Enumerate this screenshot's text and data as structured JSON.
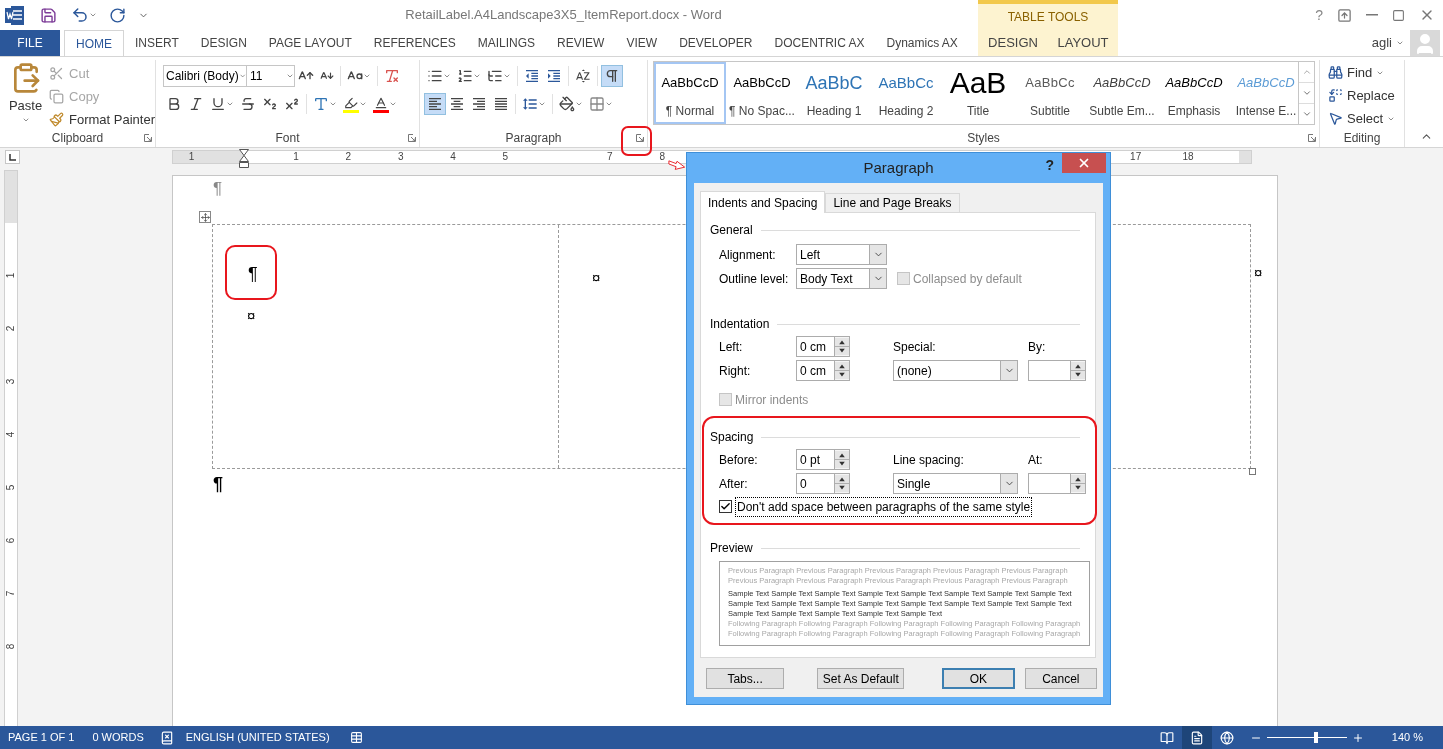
{
  "title_bar": {
    "title": "RetailLabel.A4Landscape3X5_ItemReport.docx - Word",
    "help": "?"
  },
  "tabs": [
    {
      "label": "FILE",
      "kind": "file",
      "selected": false
    },
    {
      "label": "HOME",
      "kind": "normal",
      "selected": true
    },
    {
      "label": "INSERT",
      "kind": "normal",
      "selected": false
    },
    {
      "label": "DESIGN",
      "kind": "normal",
      "selected": false
    },
    {
      "label": "PAGE LAYOUT",
      "kind": "normal",
      "selected": false
    },
    {
      "label": "REFERENCES",
      "kind": "normal",
      "selected": false
    },
    {
      "label": "MAILINGS",
      "kind": "normal",
      "selected": false
    },
    {
      "label": "REVIEW",
      "kind": "normal",
      "selected": false
    },
    {
      "label": "VIEW",
      "kind": "normal",
      "selected": false
    },
    {
      "label": "DEVELOPER",
      "kind": "normal",
      "selected": false
    },
    {
      "label": "DOCENTRIC AX",
      "kind": "normal",
      "selected": false
    },
    {
      "label": "Dynamics AX",
      "kind": "normal",
      "selected": false
    }
  ],
  "context_group": {
    "label": "TABLE TOOLS",
    "tabs": [
      {
        "label": "DESIGN",
        "selected": false
      },
      {
        "label": "LAYOUT",
        "selected": false
      }
    ]
  },
  "user": {
    "name": "agli"
  },
  "ribbon": {
    "clipboard": {
      "label": "Clipboard",
      "paste": "Paste",
      "items": [
        {
          "label": "Cut",
          "kind": "cut",
          "disabled": true
        },
        {
          "label": "Copy",
          "kind": "copy",
          "disabled": true
        },
        {
          "label": "Format Painter",
          "kind": "painter",
          "disabled": false
        }
      ]
    },
    "font": {
      "label": "Font",
      "font_name": "Calibri (Body)",
      "font_size": "11"
    },
    "paragraph": {
      "label": "Paragraph",
      "show_marks": true,
      "align_buttons": [
        {
          "kind": "left",
          "selected": true
        },
        {
          "kind": "center",
          "selected": false
        },
        {
          "kind": "right",
          "selected": false
        },
        {
          "kind": "justify",
          "selected": false
        }
      ]
    },
    "styles": {
      "label": "Styles",
      "items": [
        {
          "sample": "AaBbCcD",
          "name": "¶ Normal",
          "kind": "normal",
          "selected": true
        },
        {
          "sample": "AaBbCcD",
          "name": "¶ No Spac...",
          "kind": "normal",
          "selected": false
        },
        {
          "sample": "AaBbC",
          "name": "Heading 1",
          "kind": "heading1",
          "selected": false
        },
        {
          "sample": "AaBbCc",
          "name": "Heading 2",
          "kind": "heading2",
          "selected": false
        },
        {
          "sample": "AaB",
          "name": "Title",
          "kind": "title",
          "selected": false
        },
        {
          "sample": "AaBbCc",
          "name": "Subtitle",
          "kind": "subtitle",
          "selected": false
        },
        {
          "sample": "AaBbCcD",
          "name": "Subtle Em...",
          "kind": "subtle",
          "selected": false
        },
        {
          "sample": "AaBbCcD",
          "name": "Emphasis",
          "kind": "emphasis",
          "selected": false
        },
        {
          "sample": "AaBbCcD",
          "name": "Intense E...",
          "kind": "intense",
          "selected": false
        }
      ]
    },
    "editing": {
      "label": "Editing",
      "items": [
        {
          "label": "Find",
          "kind": "find"
        },
        {
          "label": "Replace",
          "kind": "replace"
        },
        {
          "label": "Select",
          "kind": "select"
        }
      ]
    }
  },
  "ruler": {
    "labels": [
      "1",
      "1",
      "2",
      "3",
      "4",
      "5",
      "7",
      "8",
      "17",
      "18"
    ]
  },
  "vertical_ruler": {
    "labels": [
      "1",
      "2",
      "3",
      "4",
      "5",
      "6",
      "7",
      "8"
    ]
  },
  "document": {
    "top_mark": "¶",
    "cells": [
      {
        "marks": [
          "¶",
          "¤"
        ]
      },
      {
        "marks": [
          "¤"
        ]
      }
    ],
    "row_end_mark": "¤",
    "after_table_mark": "¶"
  },
  "dialog": {
    "title": "Paragraph",
    "help": "?",
    "tabs": [
      {
        "label": "Indents and Spacing",
        "selected": true
      },
      {
        "label": "Line and Page Breaks",
        "selected": false
      }
    ],
    "general": {
      "heading": "General",
      "alignment": {
        "label": "Alignment:",
        "value": "Left"
      },
      "outline": {
        "label": "Outline level:",
        "value": "Body Text"
      },
      "collapsed": {
        "label": "Collapsed by default",
        "checked": false,
        "disabled": true
      }
    },
    "indentation": {
      "heading": "Indentation",
      "left": {
        "label": "Left:",
        "value": "0 cm"
      },
      "right": {
        "label": "Right:",
        "value": "0 cm"
      },
      "special": {
        "label": "Special:",
        "value": "(none)"
      },
      "by": {
        "label": "By:"
      },
      "mirror": {
        "label": "Mirror indents",
        "checked": false,
        "disabled": true
      }
    },
    "spacing": {
      "heading": "Spacing",
      "before": {
        "label": "Before:",
        "value": "0 pt"
      },
      "after": {
        "label": "After:",
        "value": "0"
      },
      "line_spacing": {
        "label": "Line spacing:",
        "value": "Single"
      },
      "at": {
        "label": "At:"
      },
      "dont_add": {
        "label": "Don't add space between paragraphs of the same style",
        "checked": true,
        "disabled": false
      }
    },
    "preview": {
      "heading": "Preview",
      "previous": [
        "Previous Paragraph Previous Paragraph Previous Paragraph Previous Paragraph Previous Paragraph",
        "Previous Paragraph Previous Paragraph Previous Paragraph Previous Paragraph Previous Paragraph"
      ],
      "sample": [
        "Sample Text Sample Text Sample Text Sample Text Sample Text Sample Text Sample Text Sample Text",
        "Sample Text Sample Text Sample Text Sample Text Sample Text Sample Text Sample Text Sample Text",
        "Sample Text Sample Text Sample Text Sample Text Sample Text"
      ],
      "following": [
        "Following Paragraph Following Paragraph Following Paragraph Following Paragraph Following Paragraph",
        "Following Paragraph Following Paragraph Following Paragraph Following Paragraph Following Paragraph"
      ]
    },
    "buttons": [
      {
        "label": "Tabs...",
        "default": false
      },
      {
        "label": "Set As Default",
        "default": false
      },
      {
        "label": "OK",
        "default": true
      },
      {
        "label": "Cancel",
        "default": false
      }
    ]
  },
  "status_bar": {
    "page": "PAGE 1 OF 1",
    "words": "0 WORDS",
    "language": "ENGLISH (UNITED STATES)",
    "views": [
      {
        "kind": "read",
        "selected": false
      },
      {
        "kind": "print",
        "selected": true
      },
      {
        "kind": "web",
        "selected": false
      }
    ],
    "zoom": {
      "level": 0.62
    },
    "zoom_label": "140 %"
  }
}
